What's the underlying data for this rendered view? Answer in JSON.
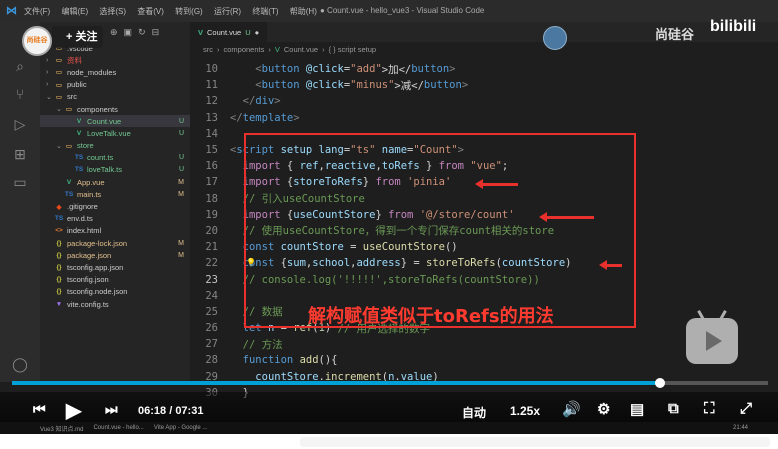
{
  "window": {
    "title": "● Count.vue - hello_vue3 - Visual Studio Code",
    "menu": [
      "文件(F)",
      "编辑(E)",
      "选择(S)",
      "查看(V)",
      "转到(G)",
      "运行(R)",
      "终端(T)",
      "帮助(H)"
    ]
  },
  "sidebar": {
    "items": [
      {
        "name": ".vscode",
        "kind": "folder",
        "indent": 0,
        "open": false,
        "badge": "",
        "color": "#cccccc"
      },
      {
        "name": "资料",
        "kind": "folder",
        "indent": 0,
        "open": false,
        "badge": "",
        "color": "#e5534b"
      },
      {
        "name": "node_modules",
        "kind": "folder",
        "indent": 0,
        "open": false,
        "badge": "",
        "color": "#cccccc"
      },
      {
        "name": "public",
        "kind": "folder",
        "indent": 0,
        "open": false,
        "badge": "",
        "color": "#cccccc"
      },
      {
        "name": "src",
        "kind": "folder",
        "indent": 0,
        "open": true,
        "badge": "",
        "color": "#cccccc"
      },
      {
        "name": "components",
        "kind": "folder",
        "indent": 1,
        "open": true,
        "badge": "",
        "color": "#cccccc"
      },
      {
        "name": "Count.vue",
        "kind": "vue",
        "indent": 2,
        "open": false,
        "badge": "U",
        "color": "#73c991",
        "selected": true
      },
      {
        "name": "LoveTalk.vue",
        "kind": "vue",
        "indent": 2,
        "open": false,
        "badge": "U",
        "color": "#73c991"
      },
      {
        "name": "store",
        "kind": "folder",
        "indent": 1,
        "open": true,
        "badge": "",
        "color": "#73c991"
      },
      {
        "name": "count.ts",
        "kind": "ts",
        "indent": 2,
        "open": false,
        "badge": "U",
        "color": "#73c991"
      },
      {
        "name": "loveTalk.ts",
        "kind": "ts",
        "indent": 2,
        "open": false,
        "badge": "U",
        "color": "#73c991"
      },
      {
        "name": "App.vue",
        "kind": "vue",
        "indent": 1,
        "open": false,
        "badge": "M",
        "color": "#e2c08d"
      },
      {
        "name": "main.ts",
        "kind": "ts",
        "indent": 1,
        "open": false,
        "badge": "M",
        "color": "#e2c08d"
      },
      {
        "name": ".gitignore",
        "kind": "git",
        "indent": 0,
        "open": false,
        "badge": "",
        "color": "#cccccc"
      },
      {
        "name": "env.d.ts",
        "kind": "ts",
        "indent": 0,
        "open": false,
        "badge": "",
        "color": "#cccccc"
      },
      {
        "name": "index.html",
        "kind": "html",
        "indent": 0,
        "open": false,
        "badge": "",
        "color": "#cccccc"
      },
      {
        "name": "package-lock.json",
        "kind": "json",
        "indent": 0,
        "open": false,
        "badge": "M",
        "color": "#e2c08d"
      },
      {
        "name": "package.json",
        "kind": "json",
        "indent": 0,
        "open": false,
        "badge": "M",
        "color": "#e2c08d"
      },
      {
        "name": "tsconfig.app.json",
        "kind": "json",
        "indent": 0,
        "open": false,
        "badge": "",
        "color": "#cccccc"
      },
      {
        "name": "tsconfig.json",
        "kind": "json",
        "indent": 0,
        "open": false,
        "badge": "",
        "color": "#cccccc"
      },
      {
        "name": "tsconfig.node.json",
        "kind": "json",
        "indent": 0,
        "open": false,
        "badge": "",
        "color": "#cccccc"
      },
      {
        "name": "vite.config.ts",
        "kind": "vite",
        "indent": 0,
        "open": false,
        "badge": "",
        "color": "#cccccc"
      }
    ]
  },
  "editor": {
    "tab_label": "Count.vue",
    "tab_status": "U",
    "breadcrumb": [
      "src",
      "components",
      "Count.vue",
      "{ } script setup"
    ],
    "lines": [
      {
        "n": "10",
        "t": [
          [
            "    ",
            ""
          ],
          [
            "<",
            "pn"
          ],
          [
            "button",
            "tag"
          ],
          [
            " @click",
            "attr"
          ],
          [
            "=",
            "txt"
          ],
          [
            "\"add\"",
            "str"
          ],
          [
            ">加</",
            "txt"
          ],
          [
            "button",
            "tag"
          ],
          [
            ">",
            "pn"
          ]
        ]
      },
      {
        "n": "11",
        "t": [
          [
            "    ",
            ""
          ],
          [
            "<",
            "pn"
          ],
          [
            "button",
            "tag"
          ],
          [
            " @click",
            "attr"
          ],
          [
            "=",
            "txt"
          ],
          [
            "\"minus\"",
            "str"
          ],
          [
            ">减</",
            "txt"
          ],
          [
            "button",
            "tag"
          ],
          [
            ">",
            "pn"
          ]
        ]
      },
      {
        "n": "12",
        "t": [
          [
            "  ",
            ""
          ],
          [
            "</",
            "pn"
          ],
          [
            "div",
            "tag"
          ],
          [
            ">",
            "pn"
          ]
        ]
      },
      {
        "n": "13",
        "t": [
          [
            "</",
            "pn"
          ],
          [
            "template",
            "tag"
          ],
          [
            ">",
            "pn"
          ]
        ]
      },
      {
        "n": "14",
        "t": []
      },
      {
        "n": "15",
        "t": [
          [
            "<",
            "pn"
          ],
          [
            "script",
            "tag"
          ],
          [
            " setup lang",
            "attr"
          ],
          [
            "=",
            "txt"
          ],
          [
            "\"ts\"",
            "str"
          ],
          [
            " name",
            "attr"
          ],
          [
            "=",
            "txt"
          ],
          [
            "\"Count\"",
            "str"
          ],
          [
            ">",
            "pn"
          ]
        ]
      },
      {
        "n": "16",
        "t": [
          [
            "  ",
            ""
          ],
          [
            "import",
            "kw2"
          ],
          [
            " { ",
            "txt"
          ],
          [
            "ref",
            "var"
          ],
          [
            ",",
            "txt"
          ],
          [
            "reactive",
            "var"
          ],
          [
            ",",
            "txt"
          ],
          [
            "toRefs",
            "var"
          ],
          [
            " } ",
            "txt"
          ],
          [
            "from",
            "kw2"
          ],
          [
            " ",
            ""
          ],
          [
            "\"vue\"",
            "str"
          ],
          [
            ";",
            "txt"
          ]
        ]
      },
      {
        "n": "17",
        "t": [
          [
            "  ",
            ""
          ],
          [
            "import",
            "kw2"
          ],
          [
            " {",
            "txt"
          ],
          [
            "storeToRefs",
            "var"
          ],
          [
            "} ",
            "txt"
          ],
          [
            "from",
            "kw2"
          ],
          [
            " ",
            ""
          ],
          [
            "'pinia'",
            "str"
          ]
        ]
      },
      {
        "n": "18",
        "t": [
          [
            "  ",
            ""
          ],
          [
            "// 引入useCountStore",
            "cm"
          ]
        ]
      },
      {
        "n": "19",
        "t": [
          [
            "  ",
            ""
          ],
          [
            "import",
            "kw2"
          ],
          [
            " {",
            "txt"
          ],
          [
            "useCountStore",
            "var"
          ],
          [
            "} ",
            "txt"
          ],
          [
            "from",
            "kw2"
          ],
          [
            " ",
            ""
          ],
          [
            "'@/store/count'",
            "str"
          ]
        ]
      },
      {
        "n": "20",
        "t": [
          [
            "  ",
            ""
          ],
          [
            "// 使用useCountStore，得到一个专门保存count相关的store",
            "cm"
          ]
        ]
      },
      {
        "n": "21",
        "t": [
          [
            "  ",
            ""
          ],
          [
            "const",
            "kw"
          ],
          [
            " ",
            ""
          ],
          [
            "countStore",
            "var"
          ],
          [
            " = ",
            "txt"
          ],
          [
            "useCountStore",
            "fn"
          ],
          [
            "()",
            "txt"
          ]
        ]
      },
      {
        "n": "22",
        "t": [
          [
            "  ",
            ""
          ],
          [
            "const",
            "kw"
          ],
          [
            " {",
            "txt"
          ],
          [
            "sum",
            "var"
          ],
          [
            ",",
            "txt"
          ],
          [
            "school",
            "var"
          ],
          [
            ",",
            "txt"
          ],
          [
            "address",
            "var"
          ],
          [
            "} = ",
            "txt"
          ],
          [
            "storeToRefs",
            "fn"
          ],
          [
            "(",
            "txt"
          ],
          [
            "countStore",
            "var"
          ],
          [
            ")",
            "txt"
          ]
        ]
      },
      {
        "n": "23",
        "t": [
          [
            "  ",
            ""
          ],
          [
            "// console.log('!!!!!',storeToRefs(countStore))",
            "cm"
          ]
        ]
      },
      {
        "n": "24",
        "t": []
      },
      {
        "n": "25",
        "t": [
          [
            "  ",
            ""
          ],
          [
            "// 数据",
            "cm"
          ]
        ]
      },
      {
        "n": "26",
        "t": [
          [
            "  ",
            ""
          ],
          [
            "let",
            "kw"
          ],
          [
            " ",
            ""
          ],
          [
            "n",
            "var"
          ],
          [
            " = ",
            "txt"
          ],
          [
            "ref",
            "fn"
          ],
          [
            "(",
            "txt"
          ],
          [
            "1",
            "num"
          ],
          [
            ") ",
            "txt"
          ],
          [
            "// 用户选择的数字",
            "cm"
          ]
        ]
      },
      {
        "n": "27",
        "t": [
          [
            "  ",
            ""
          ],
          [
            "// 方法",
            "cm"
          ]
        ]
      },
      {
        "n": "28",
        "t": [
          [
            "  ",
            ""
          ],
          [
            "function",
            "kw"
          ],
          [
            " ",
            ""
          ],
          [
            "add",
            "fn"
          ],
          [
            "(){",
            "txt"
          ]
        ]
      },
      {
        "n": "29",
        "t": [
          [
            "    ",
            ""
          ],
          [
            "countStore",
            "var"
          ],
          [
            ".",
            "txt"
          ],
          [
            "increment",
            "fn"
          ],
          [
            "(",
            "txt"
          ],
          [
            "n",
            "var"
          ],
          [
            ".",
            "txt"
          ],
          [
            "value",
            "var"
          ],
          [
            ")",
            "txt"
          ]
        ]
      },
      {
        "n": "30",
        "t": [
          [
            "  ",
            ""
          ],
          [
            "}",
            "txt"
          ]
        ]
      }
    ],
    "current_line": "23",
    "annotation": "解构赋值类似于toRefs的用法"
  },
  "video": {
    "uploader_name": "尚硅谷",
    "bili_logo": "bilibili",
    "follow_label": "+ 关注",
    "avatar_text": "尚硅谷",
    "time_current": "06:18",
    "time_separator": " / ",
    "time_total": "07:31",
    "quality_label": "自动",
    "speed_label": "1.25x",
    "progress": 0.857
  },
  "taskbar": {
    "items": [
      "Vue3 知识点.md",
      "Count.vue - hello...",
      "Vite App - Google ..."
    ],
    "clock": "21:44"
  }
}
